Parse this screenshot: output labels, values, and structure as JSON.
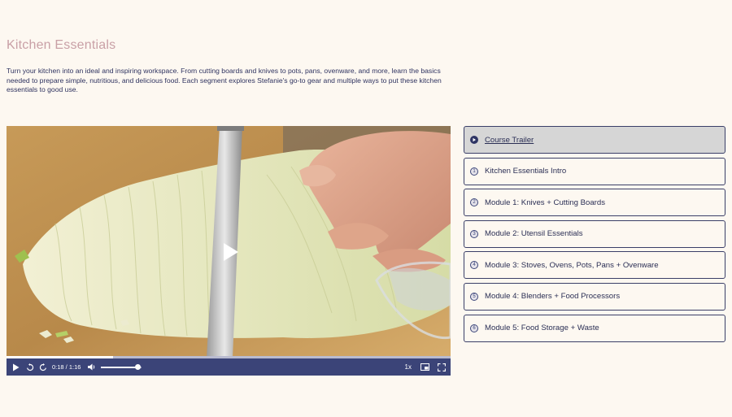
{
  "course": {
    "title": "Kitchen Essentials",
    "description": "Turn your kitchen into an ideal and inspiring workspace. From cutting boards and knives to pots, pans, ovenware, and more, learn the basics needed to prepare simple, nutritious, and delicious food. Each segment explores Stefanie's go-to gear and multiple ways to put these kitchen essentials to good use."
  },
  "player": {
    "current_time": "0:18",
    "duration": "1:16",
    "time_display": "0:18 / 1:16",
    "progress_fraction": 0.24,
    "volume_fraction": 0.9,
    "speed": "1x",
    "icons": [
      "play-icon",
      "rewind-icon",
      "forward-icon",
      "volume-icon",
      "picture-in-picture-icon",
      "fullscreen-icon"
    ]
  },
  "lessons": [
    {
      "number": "",
      "label": "Course Trailer",
      "active": true
    },
    {
      "number": "1",
      "label": "Kitchen Essentials Intro",
      "active": false
    },
    {
      "number": "2",
      "label": "Module 1: Knives + Cutting Boards",
      "active": false
    },
    {
      "number": "3",
      "label": "Module 2: Utensil Essentials",
      "active": false
    },
    {
      "number": "4",
      "label": "Module 3: Stoves, Ovens, Pots, Pans + Ovenware",
      "active": false
    },
    {
      "number": "5",
      "label": "Module 4: Blenders + Food Processors",
      "active": false
    },
    {
      "number": "6",
      "label": "Module 5: Food Storage + Waste",
      "active": false
    }
  ],
  "colors": {
    "background": "#fdf8f1",
    "title": "#c9a0a6",
    "controls_bar": "#3b4478",
    "active_lesson": "#d6d6d6"
  }
}
